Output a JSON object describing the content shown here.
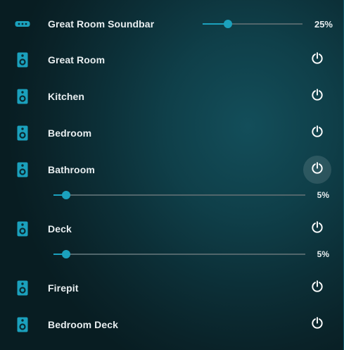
{
  "colors": {
    "accent": "#1ba1bd",
    "track": "#51666b",
    "text": "#e8eef0"
  },
  "soundbar": {
    "icon": "soundbar-icon",
    "label": "Great Room Soundbar",
    "volume": 0.25,
    "volume_text": "25%"
  },
  "speakers": [
    {
      "icon": "speaker-icon",
      "label": "Great Room",
      "power_icon": "power-icon"
    },
    {
      "icon": "speaker-icon",
      "label": "Kitchen",
      "power_icon": "power-icon"
    },
    {
      "icon": "speaker-icon",
      "label": "Bedroom",
      "power_icon": "power-icon"
    },
    {
      "icon": "speaker-icon",
      "label": "Bathroom",
      "power_icon": "power-icon",
      "volume": 0.05,
      "volume_text": "5%"
    },
    {
      "icon": "speaker-icon",
      "label": "Deck",
      "power_icon": "power-icon",
      "volume": 0.05,
      "volume_text": "5%"
    },
    {
      "icon": "speaker-icon",
      "label": "Firepit",
      "power_icon": "power-icon"
    },
    {
      "icon": "speaker-icon",
      "label": "Bedroom Deck",
      "power_icon": "power-icon"
    }
  ]
}
